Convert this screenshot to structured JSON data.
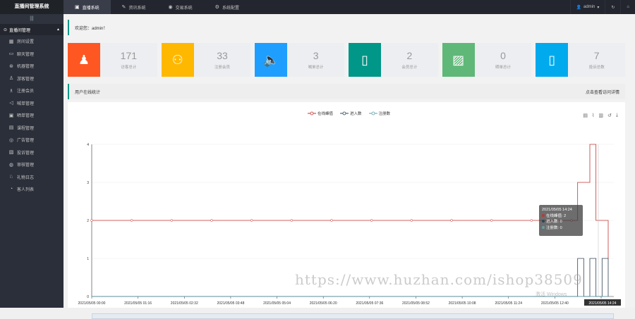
{
  "brand": "直播间管理系统",
  "topnav": [
    {
      "label": "直播系统",
      "icon": "folder-icon",
      "active": true
    },
    {
      "label": "资讯系统",
      "icon": "edit-icon",
      "active": false
    },
    {
      "label": "交易系统",
      "icon": "circle-icon",
      "active": false
    },
    {
      "label": "系统配置",
      "icon": "gear-icon",
      "active": false
    }
  ],
  "topright": {
    "user": "admin",
    "refresh": "↻",
    "home": "⌂"
  },
  "sidebar": {
    "toggle": "|||",
    "group": "直播间管理",
    "items": [
      {
        "label": "房间设置",
        "icon": "settings-icon"
      },
      {
        "label": "聊天管理",
        "icon": "chat-icon"
      },
      {
        "label": "机器管理",
        "icon": "robot-icon"
      },
      {
        "label": "游客管理",
        "icon": "user-icon"
      },
      {
        "label": "注册会员",
        "icon": "member-icon"
      },
      {
        "label": "喊单管理",
        "icon": "megaphone-icon"
      },
      {
        "label": "晒单管理",
        "icon": "order-icon"
      },
      {
        "label": "课程管理",
        "icon": "course-icon"
      },
      {
        "label": "广告管理",
        "icon": "ad-icon"
      },
      {
        "label": "投诉管理",
        "icon": "complaint-icon"
      },
      {
        "label": "审核管理",
        "icon": "audit-icon"
      },
      {
        "label": "礼物日志",
        "icon": "gift-icon"
      },
      {
        "label": "客人列表",
        "icon": "guest-icon"
      }
    ]
  },
  "welcome": "欢迎您：admin！",
  "cards": [
    {
      "num": "171",
      "label": "访客总计",
      "color": "#ff5722",
      "icon": "user-icon"
    },
    {
      "num": "33",
      "label": "注册会员",
      "color": "#ffb800",
      "icon": "users-icon"
    },
    {
      "num": "3",
      "label": "喊单总计",
      "color": "#1e9fff",
      "icon": "speaker-icon"
    },
    {
      "num": "2",
      "label": "会员总计",
      "color": "#009688",
      "icon": "document-icon"
    },
    {
      "num": "0",
      "label": "晒单总计",
      "color": "#5fb878",
      "icon": "image-icon"
    },
    {
      "num": "7",
      "label": "投诉总数",
      "color": "#01aaed",
      "icon": "tablet-icon"
    }
  ],
  "section": {
    "title": "用户在线统计",
    "right": "点击查看访问详情"
  },
  "legend": [
    {
      "name": "在线峰值",
      "color": "#c23531"
    },
    {
      "name": "进入数",
      "color": "#2f4554"
    },
    {
      "name": "注册数",
      "color": "#61a0a8"
    }
  ],
  "tooltip": {
    "title": "2021/05/05 14:24",
    "rows": [
      {
        "label": "在线峰值",
        "value": "2",
        "color": "#c23531"
      },
      {
        "label": "进入数",
        "value": "0",
        "color": "#2f4554"
      },
      {
        "label": "注册数",
        "value": "0",
        "color": "#61a0a8"
      }
    ]
  },
  "watermark": "https://www.huzhan.com/ishop38509",
  "activate": "激活 Windows",
  "chart_data": {
    "type": "line",
    "yticks": [
      "0",
      "1",
      "2",
      "3",
      "4"
    ],
    "ylim": [
      0,
      4
    ],
    "xticks": [
      "2021/05/05 00:00",
      "2021/05/05 01:16",
      "2021/05/05 02:32",
      "2021/05/05 03:48",
      "2021/05/05 05:04",
      "2021/05/05 06:20",
      "2021/05/05 07:36",
      "2021/05/05 08:52",
      "2021/05/05 10:08",
      "2021/05/05 11:24",
      "2021/05/05 12:40",
      "2021/05/05 14:24"
    ],
    "series": [
      {
        "name": "在线峰值",
        "values": [
          2,
          2,
          2,
          2,
          2,
          2,
          2,
          2,
          2,
          2,
          2,
          2,
          2,
          3,
          3,
          4,
          2,
          2,
          1
        ]
      },
      {
        "name": "进入数",
        "values": [
          0,
          0,
          0,
          0,
          0,
          0,
          0,
          0,
          0,
          0,
          0,
          0,
          0,
          1,
          0,
          1,
          0,
          1,
          0
        ]
      },
      {
        "name": "注册数",
        "values": [
          0,
          0,
          0,
          0,
          0,
          0,
          0,
          0,
          0,
          0,
          0,
          0,
          0,
          0,
          0,
          0,
          0,
          0,
          0
        ]
      }
    ]
  }
}
